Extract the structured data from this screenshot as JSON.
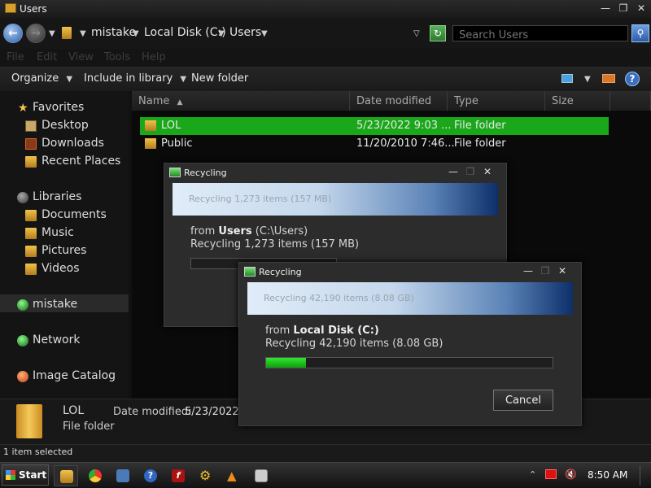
{
  "window": {
    "title": "Users"
  },
  "address": {
    "crumbs": [
      "mistake",
      "Local Disk (C:)",
      "Users"
    ],
    "search_placeholder": "Search Users"
  },
  "menu": [
    "File",
    "Edit",
    "View",
    "Tools",
    "Help"
  ],
  "toolbar": {
    "organize": "Organize",
    "include": "Include in library",
    "new_folder": "New folder"
  },
  "nav": {
    "favorites": "Favorites",
    "desktop": "Desktop",
    "downloads": "Downloads",
    "recent": "Recent Places",
    "libraries": "Libraries",
    "documents": "Documents",
    "music": "Music",
    "pictures": "Pictures",
    "videos": "Videos",
    "computer": "mistake",
    "network": "Network",
    "catalog": "Image Catalog"
  },
  "columns": {
    "name": "Name",
    "date": "Date modified",
    "type": "Type",
    "size": "Size"
  },
  "files": [
    {
      "name": "LOL",
      "date": "5/23/2022 9:03 ...",
      "type": "File folder"
    },
    {
      "name": "Public",
      "date": "11/20/2010 7:46...",
      "type": "File folder"
    }
  ],
  "details": {
    "name": "LOL",
    "date_label": "Date modified:",
    "date_value": "5/23/2022 9",
    "type": "File folder"
  },
  "status": {
    "text": "1 item selected"
  },
  "dialog1": {
    "title": "Recycling",
    "banner": "Recycling 1,273 items (157 MB)",
    "from_prefix": "from ",
    "from_name": "Users",
    "from_path": " (C:\\Users)",
    "line2": "Recycling 1,273 items (157 MB)"
  },
  "dialog2": {
    "title": "Recycling",
    "banner": "Recycling 42,190 items (8.08 GB)",
    "from_prefix": "from ",
    "from_name": "Local Disk (C:)",
    "line2": "Recycling 42,190 items (8.08 GB)",
    "progress": 0.14,
    "cancel": "Cancel"
  },
  "taskbar": {
    "start": "Start",
    "clock": "8:50 AM"
  },
  "colors": {
    "selection": "#1aa81a",
    "progress": "#20c820"
  }
}
